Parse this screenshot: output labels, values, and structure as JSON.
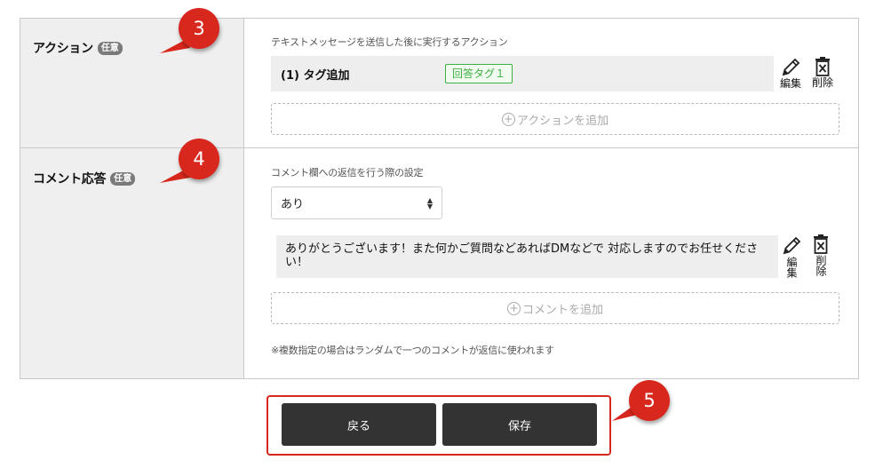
{
  "action_row": {
    "label": "アクション",
    "badge": "任意",
    "caption": "テキストメッセージを送信した後に実行するアクション",
    "item_title": "(1) タグ追加",
    "item_tag": "回答タグ１",
    "edit_label": "編集",
    "delete_label": "削除",
    "add_label": "アクションを追加"
  },
  "comment_row": {
    "label": "コメント応答",
    "badge": "任意",
    "caption": "コメント欄への返信を行う際の設定",
    "select_value": "あり",
    "comment_text": "ありがとうございます！また何かご質問などあればDMなどで 対応しますのでお任せください！",
    "edit_label": "編集",
    "delete_label": "削除",
    "add_label": "コメントを追加",
    "note": "※複数指定の場合はランダムで一つのコメントが返信に使われます"
  },
  "callouts": [
    "3",
    "4",
    "5"
  ],
  "buttons": {
    "back": "戻る",
    "save": "保存"
  },
  "colors": {
    "callout": "#d8271c",
    "tag_green": "#3cb043",
    "button_dark": "#333333"
  }
}
